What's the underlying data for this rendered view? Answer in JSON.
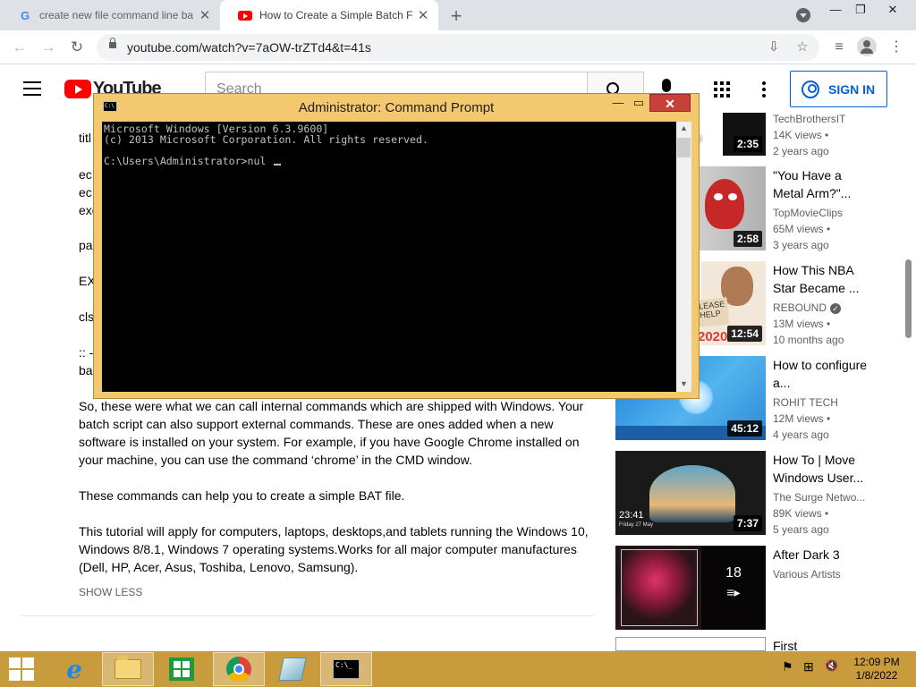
{
  "browser": {
    "tabs": [
      {
        "title": "create new file command line ba",
        "favicon": "google-icon",
        "active": false
      },
      {
        "title": "How to Create a Simple Batch Fil",
        "favicon": "youtube-icon",
        "active": true
      }
    ],
    "close_glyph": "✕",
    "new_tab_glyph": "+",
    "url": "youtube.com/watch?v=7aOW-trZTd4&t=41s",
    "window_controls": {
      "minimize": "—",
      "restore": "❐",
      "close": "✕"
    },
    "nav": {
      "back": "←",
      "forward": "→",
      "reload": "↻"
    }
  },
  "youtube": {
    "logo_text": "YouTube",
    "search_placeholder": "Search",
    "signin_label": "SIGN IN"
  },
  "description": {
    "partial_lines": [
      "titl",
      "ec",
      "ec",
      "exe",
      "pa",
      "EX",
      "cls",
      ":: -",
      "bat"
    ],
    "paragraph1": "So, these were what we can call internal commands which are shipped with Windows. Your batch script can also support external commands. These are ones added when a new software is installed on your system. For example, if you have Google Chrome installed on your machine, you can use the command ‘chrome’ in the CMD window.",
    "paragraph2": "These commands can help you to create a simple BAT file.",
    "paragraph3": "This tutorial will apply for computers, laptops, desktops,and tablets running the Windows 10, Windows 8/8.1, Windows 7 operating systems.Works for all major computer manufactures (Dell, HP, Acer, Asus, Toshiba, Lenovo, Samsung).",
    "show_less": "SHOW LESS"
  },
  "recommendations": [
    {
      "title": "",
      "channel": "TechBrothersIT",
      "views": "14K views •",
      "age": "2 years ago",
      "duration": "2:35"
    },
    {
      "title": "\"You Have a Metal Arm?\"...",
      "channel": "TopMovieClips",
      "views": "65M views •",
      "age": "3 years ago",
      "duration": "2:58"
    },
    {
      "title": "How This NBA Star Became ...",
      "channel": "REBOUND",
      "verified": "✓",
      "views": "13M views •",
      "age": "10 months ago",
      "duration": "12:54",
      "thumb_text": "2020"
    },
    {
      "title": "How to configure a...",
      "channel": "ROHIT TECH",
      "views": "12M views •",
      "age": "4 years ago",
      "duration": "45:12"
    },
    {
      "title": "How To | Move Windows User...",
      "channel": "The Surge Netwo...",
      "views": "89K views •",
      "age": "5 years ago",
      "duration": "7:37",
      "thumb_clock": "23:41",
      "thumb_date": "Friday 27 May"
    },
    {
      "title": "After Dark 3",
      "channel": "Various Artists",
      "playlist_count": "18",
      "playlist_glyph": "≡▸"
    },
    {
      "title": "First"
    }
  ],
  "cmd": {
    "title": "Administrator: Command Prompt",
    "icon_text": "C:\\",
    "lines": [
      "Microsoft Windows [Version 6.3.9600]",
      "(c) 2013 Microsoft Corporation. All rights reserved.",
      "",
      "C:\\Users\\Administrator>nul "
    ],
    "controls": {
      "minimize": "—",
      "maximize": "▭",
      "close": "✕"
    }
  },
  "taskbar": {
    "pinned": [
      "internet-explorer",
      "file-explorer",
      "windows-store",
      "chrome",
      "notepad",
      "command-prompt"
    ],
    "ie_glyph": "e",
    "cmd_icon_text": "C:\\_",
    "clock_time": "12:09 PM",
    "clock_date": "1/8/2022",
    "tray_glyphs": {
      "flag": "⚑",
      "network": "⊞",
      "volume": "🔇"
    }
  },
  "colors": {
    "taskbar": "#c89b3c",
    "cmd_frame": "#f3c86e",
    "youtube_red": "#ff0000",
    "signin_blue": "#065fd4"
  }
}
